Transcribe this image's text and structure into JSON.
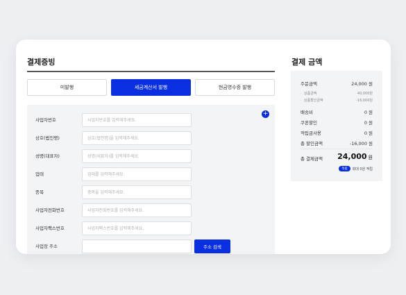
{
  "left": {
    "title": "결제증빙",
    "tabs": [
      {
        "label": "미발행",
        "active": false
      },
      {
        "label": "세금계산서 발행",
        "active": true
      },
      {
        "label": "현금영수증 발행",
        "active": false
      }
    ],
    "plus": "+",
    "fields": [
      {
        "label": "사업자번호",
        "placeholder": "사업자번호를 입력해주세요."
      },
      {
        "label": "상호(법인명)",
        "placeholder": "상호(법인명)을 입력해주세요."
      },
      {
        "label": "성명(대표자)",
        "placeholder": "성명(대표자)를 입력해주세요."
      },
      {
        "label": "업태",
        "placeholder": "업태를 입력해주세요."
      },
      {
        "label": "종목",
        "placeholder": "종목을 입력해주세요."
      },
      {
        "label": "사업자전화번호",
        "placeholder": "사업자전화번호를 입력해주세요."
      },
      {
        "label": "사업자팩스번호",
        "placeholder": "사업자팩스번호를 입력해주세요."
      },
      {
        "label": "사업장 주소",
        "placeholder": ""
      }
    ],
    "search_label": "주소 검색"
  },
  "right": {
    "title": "결제 금액",
    "order": {
      "label": "주문금액",
      "value": "24,000 원"
    },
    "sub": [
      {
        "label": "상품금액",
        "value": "40,000원"
      },
      {
        "label": "상품할인금액",
        "value": "-16,000원"
      }
    ],
    "rows": [
      {
        "label": "배송비",
        "value": "0 원"
      },
      {
        "label": "쿠폰할인",
        "value": "0 원"
      },
      {
        "label": "적립금사용",
        "value": "0 원"
      },
      {
        "label": "총 할인금액",
        "value": "-16,000 원"
      }
    ],
    "total": {
      "label": "총 결제금액",
      "value": "24,000",
      "unit": "원"
    },
    "reward": {
      "badge": "적립",
      "text": "회대 0원 적립"
    }
  },
  "colors": {
    "accent": "#0a2fe0",
    "panel": "#f3f4f6"
  }
}
